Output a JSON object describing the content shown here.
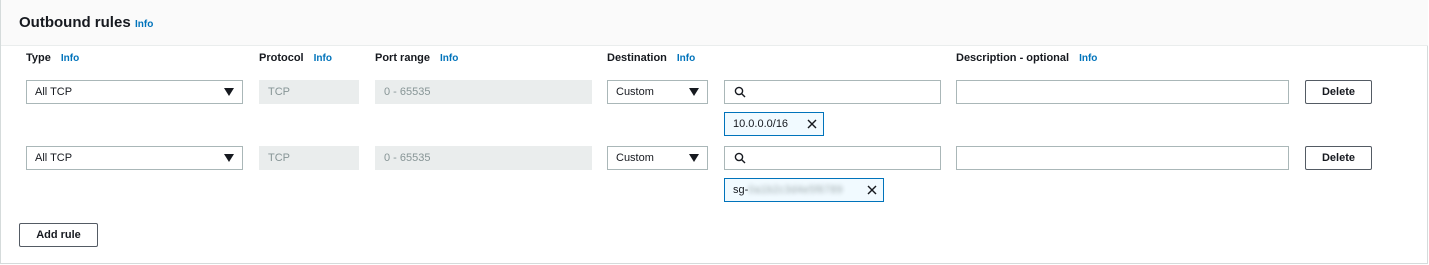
{
  "section": {
    "title": "Outbound rules",
    "info": "Info"
  },
  "columns": {
    "type": "Type",
    "protocol": "Protocol",
    "port_range": "Port range",
    "destination": "Destination",
    "description": "Description - optional",
    "info": "Info"
  },
  "rules": [
    {
      "type": "All TCP",
      "protocol": "TCP",
      "port_range": "0 - 65535",
      "destination_mode": "Custom",
      "search_value": "",
      "description_value": "",
      "token_visible": "10.0.0.0/16",
      "token_obscured": "",
      "delete_label": "Delete"
    },
    {
      "type": "All TCP",
      "protocol": "TCP",
      "port_range": "0 - 65535",
      "destination_mode": "Custom",
      "search_value": "",
      "description_value": "",
      "token_visible": "sg-",
      "token_obscured": "0a1b2c3d4e5f6789",
      "delete_label": "Delete"
    }
  ],
  "add_rule_label": "Add rule"
}
